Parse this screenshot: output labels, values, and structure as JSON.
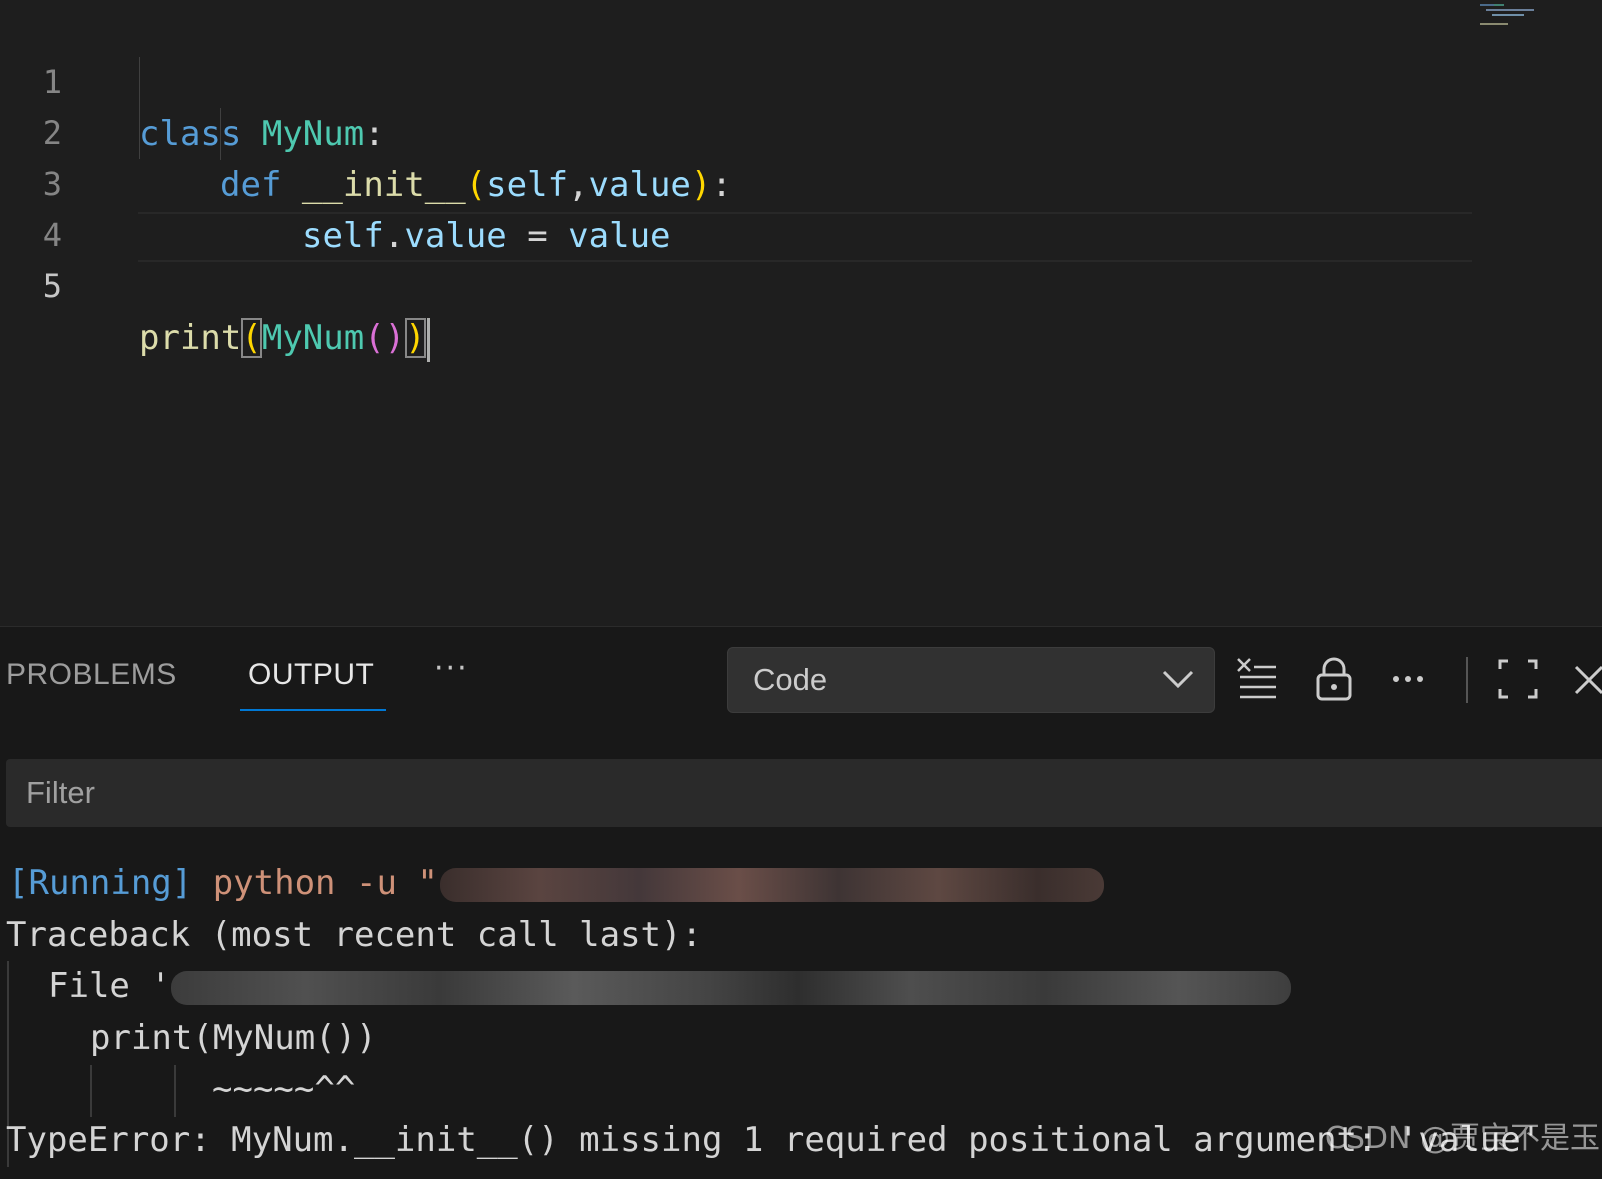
{
  "editor": {
    "line_numbers": [
      "1",
      "2",
      "3",
      "4",
      "5"
    ],
    "line1": {
      "kw": "class",
      "name": "MyNum",
      "colon": ":"
    },
    "line2": {
      "kw": "def",
      "fn": "__init__",
      "open": "(",
      "p1": "self",
      "comma": ",",
      "p2": "value",
      "close": ")",
      "colon": ":"
    },
    "line3": {
      "obj": "self",
      "dot": ".",
      "attr": "value",
      "op": " = ",
      "rhs": "value"
    },
    "line5": {
      "fn": "print",
      "open": "(",
      "cls": "MyNum",
      "call": "()",
      "close": ")"
    }
  },
  "panel": {
    "tabs": [
      {
        "label": "PROBLEMS"
      },
      {
        "label": "OUTPUT"
      }
    ],
    "more_label": "···",
    "channel": {
      "selected": "Code"
    },
    "filter": {
      "placeholder": "Filter"
    },
    "output": {
      "running_tag": "[Running]",
      "running_cmd": " python -u \"",
      "traceback": "Traceback (most recent call last):",
      "file_prefix": "File '",
      "code_line": "print(MyNum())",
      "caret_line": "~~~~~^^",
      "error": "TypeError: MyNum.__init__() missing 1 required positional argument: 'value'"
    },
    "watermark": "CSDN @贾宝不是玉"
  },
  "icons": {
    "clear": "clear-output-icon",
    "lock": "lock-icon",
    "more": "more-actions-icon",
    "maximize": "maximize-icon",
    "close": "close-icon",
    "chevron": "chevron-down-icon"
  },
  "colors": {
    "keyword": "#569cd6",
    "class": "#4ec9b0",
    "function": "#dcdcaa",
    "variable": "#9cdcfe",
    "bracket1": "#ffd700",
    "bracket2": "#da70d6",
    "string": "#ce9178",
    "accent": "#0078d4"
  }
}
